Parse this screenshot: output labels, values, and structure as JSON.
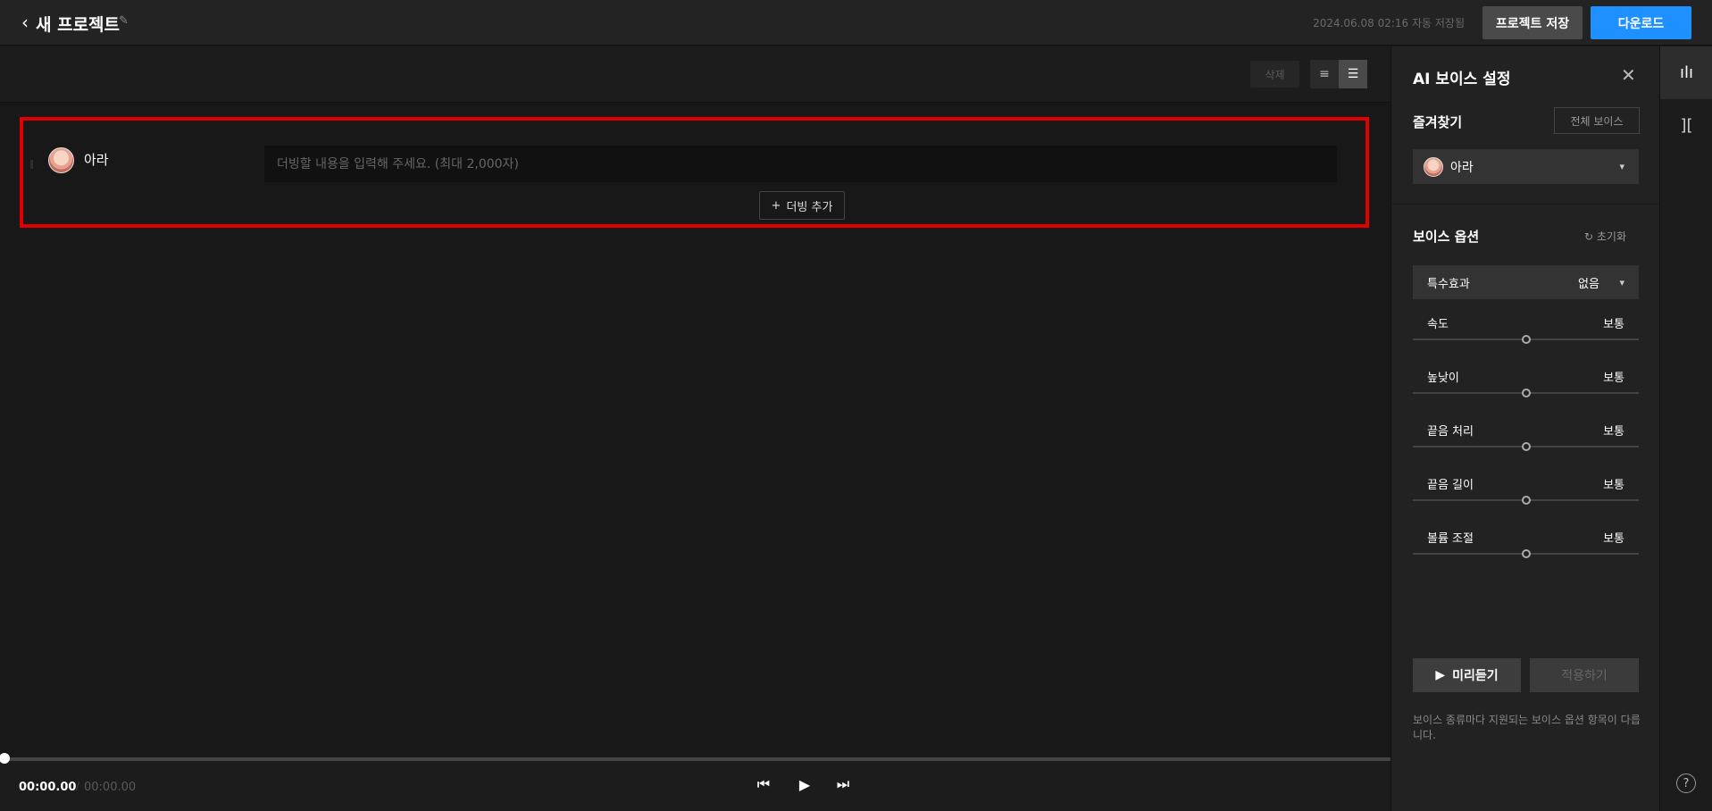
{
  "header": {
    "back_icon": "chevron-left-icon",
    "project_title": "새 프로젝트",
    "edit_icon": "pencil-icon",
    "autosave_text": "2024.06.08 02:16 자동 저장됨",
    "save_label": "프로젝트 저장",
    "download_label": "다운로드",
    "download_color": "#1e90ff"
  },
  "toolbar": {
    "delete_label": "삭제",
    "view_list_icon": "list-view-icon",
    "view_block_icon": "block-view-icon"
  },
  "dubbing": {
    "highlight_color": "#e00000",
    "rows": [
      {
        "speaker": "아라",
        "text": "",
        "placeholder": "더빙할 내용을 입력해 주세요. (최대 2,000자)"
      }
    ],
    "add_label": "더빙 추가",
    "add_icon": "+"
  },
  "player": {
    "current_time": "00:00.00",
    "separator": "/",
    "total_time": "00:00.00",
    "progress": 0
  },
  "voice_panel": {
    "title": "AI 보이스 설정",
    "favorites_label": "즐겨찾기",
    "all_voices_label": "전체 보이스",
    "selected_voice": "아라",
    "options_label": "보이스 옵션",
    "reset_label": "초기화",
    "effect": {
      "label": "특수효과",
      "value": "없음"
    },
    "sliders": [
      {
        "label": "속도",
        "value": "보통",
        "level": 0.5
      },
      {
        "label": "높낮이",
        "value": "보통",
        "level": 0.5
      },
      {
        "label": "끝음 처리",
        "value": "보통",
        "level": 0.5
      },
      {
        "label": "끝음 길이",
        "value": "보통",
        "level": 0.5
      },
      {
        "label": "볼륨 조절",
        "value": "보통",
        "level": 0.5
      }
    ],
    "preview_label": "미리듣기",
    "apply_label": "적용하기",
    "note": "보이스 종류마다 지원되는 보이스 옵션 항목이 다릅니다."
  },
  "sidebar": {
    "tabs": [
      "voice-wave-icon",
      "split-icon"
    ],
    "help": "?"
  }
}
